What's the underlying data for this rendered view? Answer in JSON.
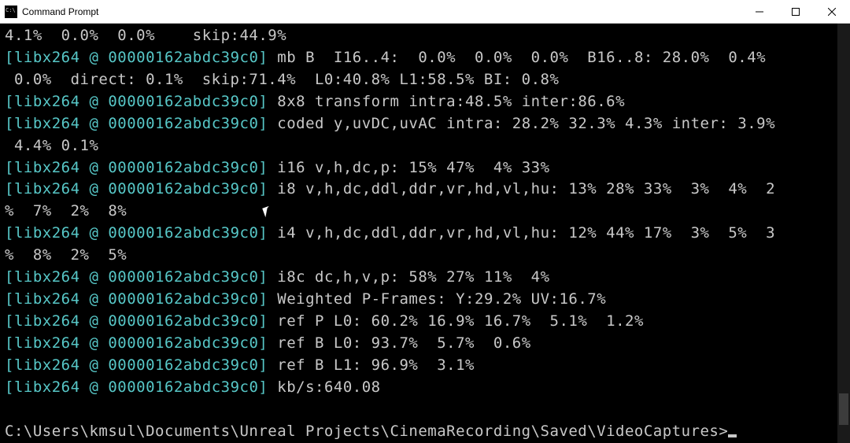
{
  "window": {
    "title": "Command Prompt"
  },
  "prefix": {
    "open": "[",
    "tag": "libx264",
    "at": " @ ",
    "addr": "00000162abdc39c0",
    "close": "] "
  },
  "lines": {
    "l0": "4.1%  0.0%  0.0%    skip:44.9%",
    "l1": "mb B  I16..4:  0.0%  0.0%  0.0%  B16..8: 28.0%  0.4%",
    "l2": " 0.0%  direct: 0.1%  skip:71.4%  L0:40.8% L1:58.5% BI: 0.8%",
    "l3": "8x8 transform intra:48.5% inter:86.6%",
    "l4": "coded y,uvDC,uvAC intra: 28.2% 32.3% 4.3% inter: 3.9%",
    "l5": " 4.4% 0.1%",
    "l6": "i16 v,h,dc,p: 15% 47%  4% 33%",
    "l7": "i8 v,h,dc,ddl,ddr,vr,hd,vl,hu: 13% 28% 33%  3%  4%  2",
    "l8": "%  7%  2%  8%",
    "l9": "i4 v,h,dc,ddl,ddr,vr,hd,vl,hu: 12% 44% 17%  3%  5%  3",
    "l10": "%  8%  2%  5%",
    "l11": "i8c dc,h,v,p: 58% 27% 11%  4%",
    "l12": "Weighted P-Frames: Y:29.2% UV:16.7%",
    "l13": "ref P L0: 60.2% 16.9% 16.7%  5.1%  1.2%",
    "l14": "ref B L0: 93.7%  5.7%  0.6%",
    "l15": "ref B L1: 96.9%  3.1%",
    "l16": "kb/s:640.08",
    "prompt": "C:\\Users\\kmsul\\Documents\\Unreal Projects\\CinemaRecording\\Saved\\VideoCaptures>"
  }
}
